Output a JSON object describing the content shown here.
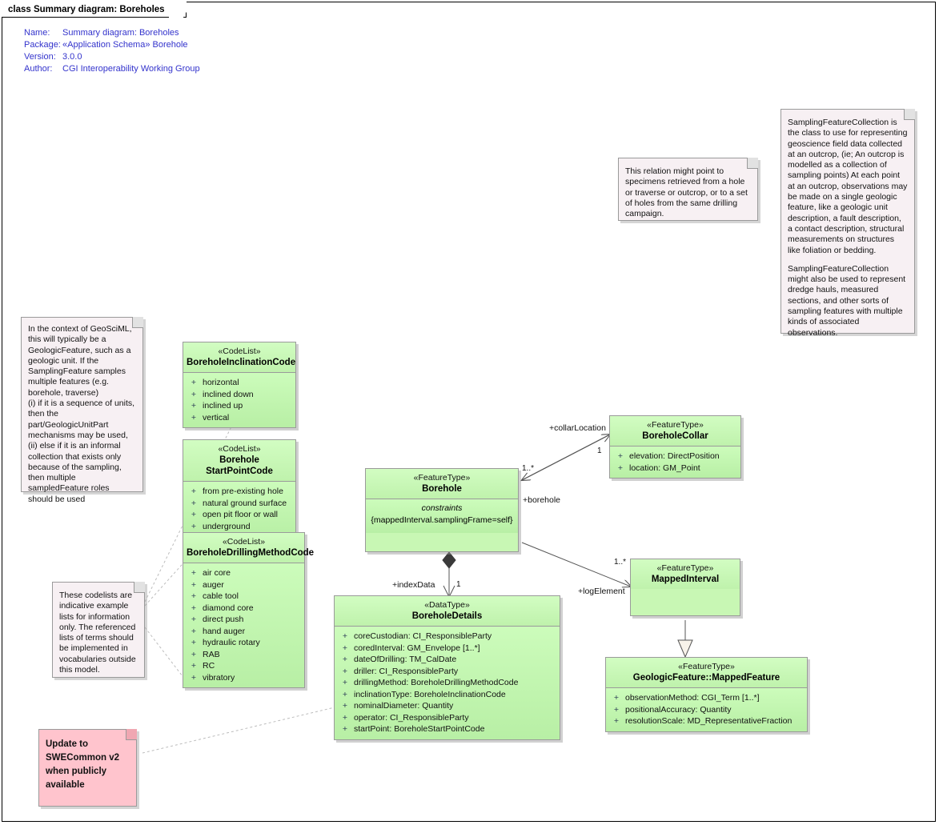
{
  "frame": {
    "tab_label": "class Summary diagram: Boreholes"
  },
  "meta": {
    "rows": [
      {
        "key": "Name:",
        "value": "Summary diagram: Boreholes"
      },
      {
        "key": "Package:",
        "value": "«Application Schema» Borehole"
      },
      {
        "key": "Version:",
        "value": "3.0.0"
      },
      {
        "key": "Author:",
        "value": "CGI Interoperability Working Group"
      }
    ]
  },
  "classes": [
    {
      "id": "boreholeInclinationCode",
      "stereotype": "«CodeList»",
      "name": "BoreholeInclinationCode",
      "features": [
        {
          "vis": "+",
          "text": "horizontal"
        },
        {
          "vis": "+",
          "text": "inclined down"
        },
        {
          "vis": "+",
          "text": "inclined up"
        },
        {
          "vis": "+",
          "text": "vertical"
        }
      ]
    },
    {
      "id": "boreholeStartPointCode",
      "stereotype": "«CodeList»",
      "name": "Borehole StartPointCode",
      "features": [
        {
          "vis": "+",
          "text": "from pre-existing hole"
        },
        {
          "vis": "+",
          "text": "natural ground surface"
        },
        {
          "vis": "+",
          "text": "open pit floor or wall"
        },
        {
          "vis": "+",
          "text": "underground"
        }
      ]
    },
    {
      "id": "boreholeDrillingMethodCode",
      "stereotype": "«CodeList»",
      "name": "BoreholeDrillingMethodCode",
      "features": [
        {
          "vis": "+",
          "text": "air core"
        },
        {
          "vis": "+",
          "text": "auger"
        },
        {
          "vis": "+",
          "text": "cable tool"
        },
        {
          "vis": "+",
          "text": "diamond core"
        },
        {
          "vis": "+",
          "text": "direct push"
        },
        {
          "vis": "+",
          "text": "hand auger"
        },
        {
          "vis": "+",
          "text": "hydraulic rotary"
        },
        {
          "vis": "+",
          "text": "RAB"
        },
        {
          "vis": "+",
          "text": "RC"
        },
        {
          "vis": "+",
          "text": "vibratory"
        }
      ]
    },
    {
      "id": "borehole",
      "stereotype": "«FeatureType»",
      "name": "Borehole",
      "constraint_title": "constraints",
      "constraint_text": "{mappedInterval.samplingFrame=self}"
    },
    {
      "id": "boreholeCollar",
      "stereotype": "«FeatureType»",
      "name": "BoreholeCollar",
      "features": [
        {
          "vis": "+",
          "text": "elevation: DirectPosition"
        },
        {
          "vis": "+",
          "text": "location: GM_Point"
        }
      ]
    },
    {
      "id": "mappedInterval",
      "stereotype": "«FeatureType»",
      "name": "MappedInterval",
      "features": []
    },
    {
      "id": "boreholeDetails",
      "stereotype": "«DataType»",
      "name": "BoreholeDetails",
      "features": [
        {
          "vis": "+",
          "text": "coreCustodian: CI_ResponsibleParty"
        },
        {
          "vis": "+",
          "text": "coredInterval: GM_Envelope [1..*]"
        },
        {
          "vis": "+",
          "text": "dateOfDrilling: TM_CalDate"
        },
        {
          "vis": "+",
          "text": "driller: CI_ResponsibleParty"
        },
        {
          "vis": "+",
          "text": "drillingMethod: BoreholeDrillingMethodCode"
        },
        {
          "vis": "+",
          "text": "inclinationType: BoreholeInclinationCode"
        },
        {
          "vis": "+",
          "text": "nominalDiameter: Quantity"
        },
        {
          "vis": "+",
          "text": "operator: CI_ResponsibleParty"
        },
        {
          "vis": "+",
          "text": "startPoint: BoreholeStartPointCode"
        }
      ]
    },
    {
      "id": "mappedFeature",
      "stereotype": "«FeatureType»",
      "name": "GeologicFeature::MappedFeature",
      "features": [
        {
          "vis": "+",
          "text": "observationMethod: CGI_Term [1..*]"
        },
        {
          "vis": "+",
          "text": "positionalAccuracy: Quantity"
        },
        {
          "vis": "+",
          "text": "resolutionScale: MD_RepresentativeFraction"
        }
      ]
    }
  ],
  "notes": [
    {
      "id": "samplingFeatureCollectionNote",
      "paragraphs": [
        "SamplingFeatureCollection is the class to use for representing geoscience field data collected at an outcrop, (ie; An outcrop is modelled as a collection of sampling points)  At each point at an outcrop, observations may be made on a single geologic feature, like a geologic unit description, a fault description, a contact description, structural measurements on structures like foliation or bedding.",
        "SamplingFeatureCollection might also be used to represent dredge hauls, measured sections, and other sorts of sampling features with multiple kinds of associated observations."
      ]
    },
    {
      "id": "relationNote",
      "paragraphs": [
        "This relation might point to specimens retrieved from a hole or traverse or outcrop, or to a set of holes from the same drilling campaign."
      ]
    },
    {
      "id": "geosciMLContextNote",
      "paragraphs": [
        "In the context of GeoSciML, this will typically be a GeologicFeature, such as a geologic unit. If the SamplingFeature samples multiple features (e.g. borehole, traverse)",
        "(i) if it is a sequence of units, then the part/GeologicUnitPart mechanisms may be used,",
        "(ii) else if it is an informal collection that exists only because of the sampling, then multiple sampledFeature roles should be used"
      ]
    },
    {
      "id": "codelistsNote",
      "paragraphs": [
        "These codelists are indicative example lists for information only. The referenced lists of terms should be implemented in vocabularies outside this model."
      ]
    },
    {
      "id": "sweCommonNote",
      "paragraphs": [
        "Update to SWECommon v2 when publicly available"
      ]
    }
  ],
  "connectors": [
    {
      "id": "collarLocation",
      "role": "+collarLocation",
      "mult": "1"
    },
    {
      "id": "boreholeRole",
      "role": "+borehole",
      "mult": "1..*"
    },
    {
      "id": "logElement",
      "role": "+logElement",
      "mult": "1..*"
    },
    {
      "id": "indexData",
      "role": "+indexData",
      "mult": "1"
    }
  ],
  "colors": {
    "class_fill": "#c8f7b4",
    "class_border": "#9a9a9a",
    "note_fill": "#f7f0f3",
    "note_pink_fill": "#ffc4cd",
    "meta_text": "#3333cc",
    "connector": "#555555"
  }
}
